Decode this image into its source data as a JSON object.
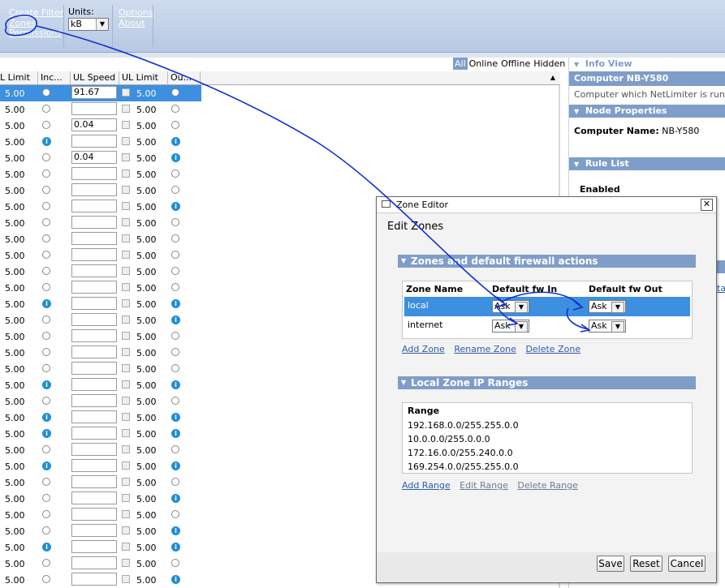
{
  "toolbar": {
    "links_group1": [
      "Create Filter",
      "Zones",
      "Permissions"
    ],
    "units_label": "Units:",
    "units_value": "kB",
    "links_group2": [
      "Options",
      "About"
    ]
  },
  "filters": [
    "All",
    "Online",
    "Offline",
    "Hidden"
  ],
  "filters_active": "All",
  "grid": {
    "columns": [
      "L Limit",
      "Inc...",
      "UL Speed",
      "UL Limit",
      "Ou..."
    ],
    "rows": [
      {
        "limit": "5.00",
        "in": "radio",
        "speed": "91.67",
        "ul": "5.00",
        "out": "radio",
        "selected": true
      },
      {
        "limit": "5.00",
        "in": "radio",
        "speed": "",
        "ul": "5.00",
        "out": "radio"
      },
      {
        "limit": "5.00",
        "in": "radio",
        "speed": "0.04",
        "ul": "5.00",
        "out": "radio"
      },
      {
        "limit": "5.00",
        "in": "up",
        "speed": "",
        "ul": "5.00",
        "out": "up"
      },
      {
        "limit": "5.00",
        "in": "radio",
        "speed": "0.04",
        "ul": "5.00",
        "out": "up"
      },
      {
        "limit": "5.00",
        "in": "radio",
        "speed": "",
        "ul": "5.00",
        "out": "radio"
      },
      {
        "limit": "5.00",
        "in": "radio",
        "speed": "",
        "ul": "5.00",
        "out": "radio"
      },
      {
        "limit": "5.00",
        "in": "radio",
        "speed": "",
        "ul": "5.00",
        "out": "up"
      },
      {
        "limit": "5.00",
        "in": "radio",
        "speed": "",
        "ul": "5.00",
        "out": "radio"
      },
      {
        "limit": "5.00",
        "in": "radio",
        "speed": "",
        "ul": "5.00",
        "out": "radio"
      },
      {
        "limit": "5.00",
        "in": "radio",
        "speed": "",
        "ul": "5.00",
        "out": "radio"
      },
      {
        "limit": "5.00",
        "in": "radio",
        "speed": "",
        "ul": "5.00",
        "out": "radio"
      },
      {
        "limit": "5.00",
        "in": "radio",
        "speed": "",
        "ul": "5.00",
        "out": "radio"
      },
      {
        "limit": "5.00",
        "in": "up",
        "speed": "",
        "ul": "5.00",
        "out": "up"
      },
      {
        "limit": "5.00",
        "in": "radio",
        "speed": "",
        "ul": "5.00",
        "out": "up"
      },
      {
        "limit": "5.00",
        "in": "radio",
        "speed": "",
        "ul": "5.00",
        "out": "radio"
      },
      {
        "limit": "5.00",
        "in": "radio",
        "speed": "",
        "ul": "5.00",
        "out": "radio"
      },
      {
        "limit": "5.00",
        "in": "radio",
        "speed": "",
        "ul": "5.00",
        "out": "radio"
      },
      {
        "limit": "5.00",
        "in": "up",
        "speed": "",
        "ul": "5.00",
        "out": "up"
      },
      {
        "limit": "5.00",
        "in": "radio",
        "speed": "",
        "ul": "5.00",
        "out": "radio"
      },
      {
        "limit": "5.00",
        "in": "up",
        "speed": "",
        "ul": "5.00",
        "out": "up"
      },
      {
        "limit": "5.00",
        "in": "up",
        "speed": "",
        "ul": "5.00",
        "out": "up"
      },
      {
        "limit": "5.00",
        "in": "radio",
        "speed": "",
        "ul": "5.00",
        "out": "radio"
      },
      {
        "limit": "5.00",
        "in": "up",
        "speed": "",
        "ul": "5.00",
        "out": "up"
      },
      {
        "limit": "5.00",
        "in": "radio",
        "speed": "",
        "ul": "5.00",
        "out": "radio"
      },
      {
        "limit": "5.00",
        "in": "radio",
        "speed": "",
        "ul": "5.00",
        "out": "up"
      },
      {
        "limit": "5.00",
        "in": "radio",
        "speed": "",
        "ul": "5.00",
        "out": "radio"
      },
      {
        "limit": "5.00",
        "in": "radio",
        "speed": "",
        "ul": "5.00",
        "out": "up"
      },
      {
        "limit": "5.00",
        "in": "up",
        "speed": "",
        "ul": "5.00",
        "out": "up"
      },
      {
        "limit": "5.00",
        "in": "radio",
        "speed": "",
        "ul": "5.00",
        "out": "radio"
      },
      {
        "limit": "5.00",
        "in": "radio",
        "speed": "",
        "ul": "5.00",
        "out": "up"
      }
    ]
  },
  "right_panel": {
    "info_view": "Info View",
    "computer_title": "Computer NB-Y580",
    "computer_desc": "Computer which NetLimiter is running o",
    "node_properties": "Node Properties",
    "computer_name_label": "Computer Name:",
    "computer_name_value": "NB-Y580",
    "rule_list": "Rule List",
    "enabled": "Enabled",
    "partial_text": "ta"
  },
  "dialog": {
    "title": "Zone Editor",
    "heading": "Edit Zones",
    "zones_section": "Zones and default firewall actions",
    "zones_columns": [
      "Zone Name",
      "Default fw In",
      "Default fw Out"
    ],
    "zones": [
      {
        "name": "local",
        "fw_in": "Ask",
        "fw_out": "Ask",
        "selected": true
      },
      {
        "name": "internet",
        "fw_in": "Ask",
        "fw_out": "Ask",
        "selected": false
      }
    ],
    "zone_actions": [
      "Add Zone",
      "Rename Zone",
      "Delete Zone"
    ],
    "ranges_section": "Local Zone IP Ranges",
    "ranges_column": "Range",
    "ranges": [
      "192.168.0.0/255.255.0.0",
      "10.0.0.0/255.0.0.0",
      "172.16.0.0/255.240.0.0",
      "169.254.0.0/255.255.0.0"
    ],
    "range_actions": [
      "Add Range",
      "Edit Range",
      "Delete Range"
    ],
    "buttons": {
      "save": "Save",
      "reset": "Reset",
      "cancel": "Cancel"
    }
  },
  "colors": {
    "accent": "#7f9dc9",
    "selection": "#3d8fe0",
    "annotation": "#1030d0"
  }
}
